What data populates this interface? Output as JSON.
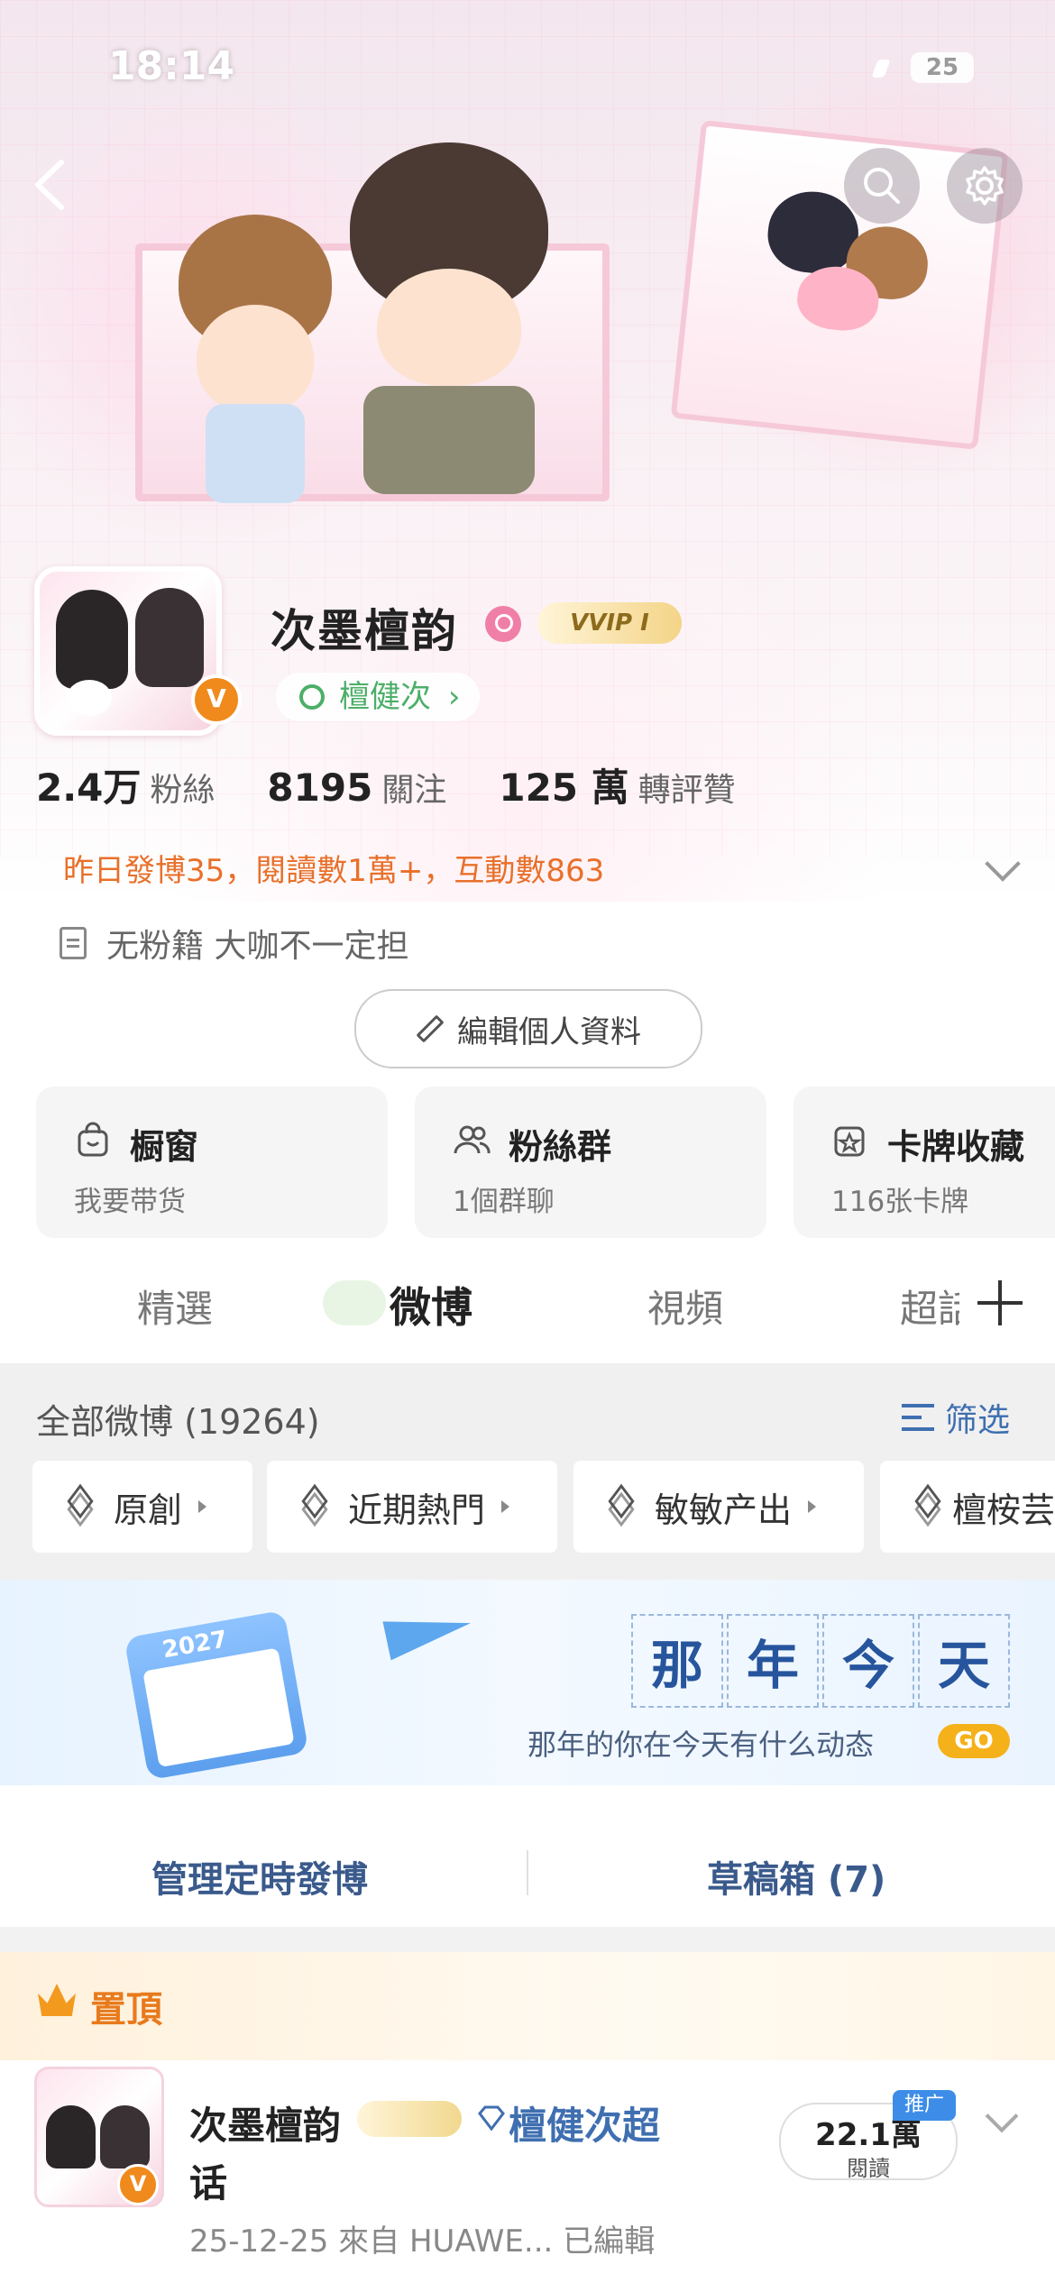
{
  "status_bar": {
    "time": "18:14",
    "battery": "25"
  },
  "profile": {
    "name": "次墨檀韵",
    "vip_badge": "VVIP Ⅰ",
    "super_chat_link": "檀健次",
    "verified_mark": "V",
    "stats": [
      {
        "num": "2.4万",
        "label": "粉絲"
      },
      {
        "num": "8195",
        "label": "關注"
      },
      {
        "num": "125 萬",
        "label": "轉評贊"
      }
    ],
    "yesterday_summary": "昨日發博35，閱讀數1萬+，互動數863",
    "bio": "无粉籍 大咖不一定担",
    "edit_button": "編輯個人資料"
  },
  "cards": [
    {
      "title": "橱窗",
      "sub": "我要带货",
      "icon": "shopping-bag-icon"
    },
    {
      "title": "粉絲群",
      "sub": "1個群聊",
      "icon": "group-icon"
    },
    {
      "title": "卡牌收藏",
      "sub": "116张卡牌",
      "icon": "card-star-icon"
    }
  ],
  "tabs": [
    "精選",
    "微博",
    "視頻",
    "超話"
  ],
  "active_tab": "微博",
  "feed": {
    "count_label": "全部微博 (19264)",
    "filter_label": "筛选",
    "chips": [
      "原創",
      "近期熱門",
      "敏敏产出",
      "檀桉芸"
    ]
  },
  "memory_banner": {
    "chars": [
      "那",
      "年",
      "今",
      "天"
    ],
    "subtitle": "那年的你在今天有什么动态",
    "go": "GO",
    "calendar_year": "2027"
  },
  "actions": {
    "scheduled": "管理定時發博",
    "drafts": "草稿箱 (7)"
  },
  "pinned": {
    "label": "置頂",
    "post_name_line1": "次墨檀韵",
    "post_name_line2": "话",
    "super_chat": "檀健次超",
    "meta": "25-12-25  來自 HUAWE...  已編輯",
    "reads_num": "22.1萬",
    "reads_label": "閱讀",
    "promo": "推广"
  },
  "colors": {
    "accent_orange": "#e8702a",
    "link_blue": "#3f6fb0",
    "green": "#4caf68",
    "pink": "#f07fa8"
  }
}
